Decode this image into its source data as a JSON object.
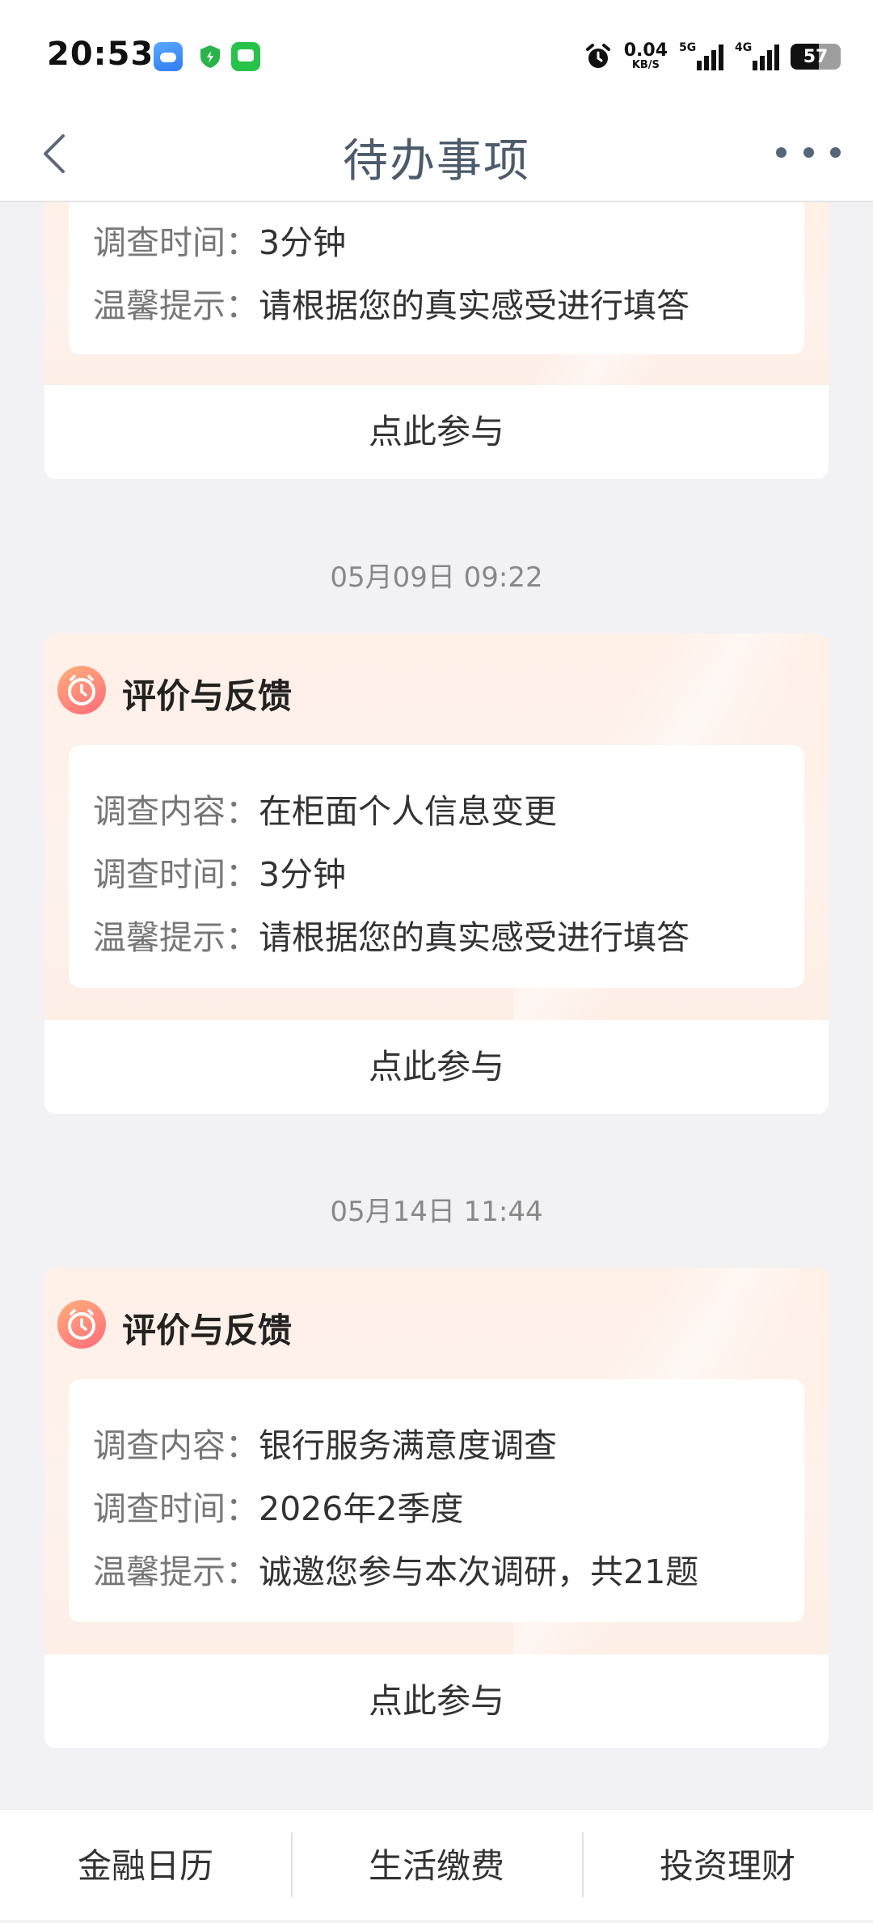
{
  "status_bar": {
    "time": "20:53",
    "net_speed": "0.04",
    "net_unit": "KB/S",
    "sim1": "5G",
    "sim2": "4G",
    "battery": "57",
    "battery_level": 0.57
  },
  "header": {
    "title": "待办事项"
  },
  "cards": [
    {
      "rows": [
        {
          "key": "调查时间：",
          "value": "3分钟"
        },
        {
          "key": "温馨提示：",
          "value": "请根据您的真实感受进行填答"
        }
      ],
      "action": "点此参与"
    },
    {
      "date": "05月09日 09:22",
      "title": "评价与反馈",
      "rows": [
        {
          "key": "调查内容：",
          "value": "在柜面个人信息变更"
        },
        {
          "key": "调查时间：",
          "value": "3分钟"
        },
        {
          "key": "温馨提示：",
          "value": "请根据您的真实感受进行填答"
        }
      ],
      "action": "点此参与"
    },
    {
      "date": "05月14日 11:44",
      "title": "评价与反馈",
      "rows": [
        {
          "key": "调查内容：",
          "value": "银行服务满意度调查"
        },
        {
          "key": "调查时间：",
          "value": "2026年2季度"
        },
        {
          "key": "温馨提示：",
          "value": "诚邀您参与本次调研，共21题"
        }
      ],
      "action": "点此参与"
    }
  ],
  "bottom_tabs": [
    "金融日历",
    "生活缴费",
    "投资理财"
  ]
}
